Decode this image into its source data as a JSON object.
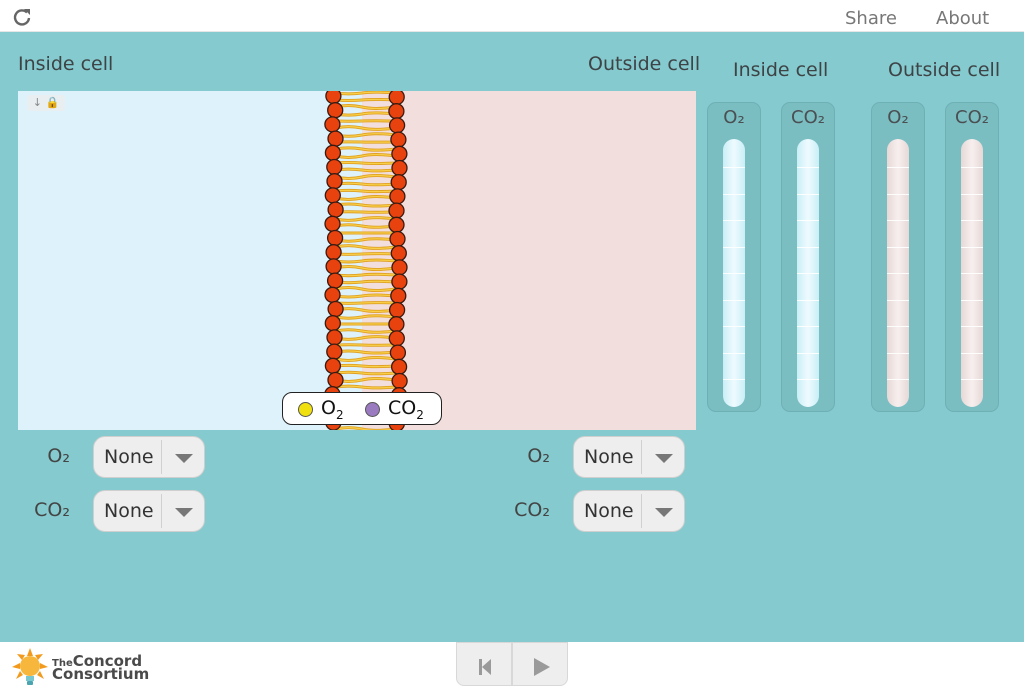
{
  "topbar": {
    "share_label": "Share",
    "about_label": "About"
  },
  "main": {
    "inside_label": "Inside cell",
    "outside_label": "Outside cell",
    "gauges_inside_label": "Inside cell",
    "gauges_outside_label": "Outside cell",
    "legend": {
      "o2": "O",
      "co2": "CO",
      "sub2": "2"
    },
    "gauges": [
      {
        "label": "O₂",
        "color": "blue"
      },
      {
        "label": "CO₂",
        "color": "blue"
      },
      {
        "label": "O₂",
        "color": "pink"
      },
      {
        "label": "CO₂",
        "color": "pink"
      }
    ],
    "controls": {
      "inside_o2_label": "O₂",
      "inside_o2_value": "None",
      "inside_co2_label": "CO₂",
      "inside_co2_value": "None",
      "outside_o2_label": "O₂",
      "outside_o2_value": "None",
      "outside_co2_label": "CO₂",
      "outside_co2_value": "None"
    }
  },
  "footer": {
    "logo_the": "The",
    "logo_line1": "Concord",
    "logo_line2": "Consortium"
  },
  "colors": {
    "background": "#84cace",
    "inside": "#def2fb",
    "outside": "#f2dfdd",
    "o2_dot": "#f0e010",
    "co2_dot": "#9b7bbf",
    "lipid_head": "#e8420e"
  }
}
